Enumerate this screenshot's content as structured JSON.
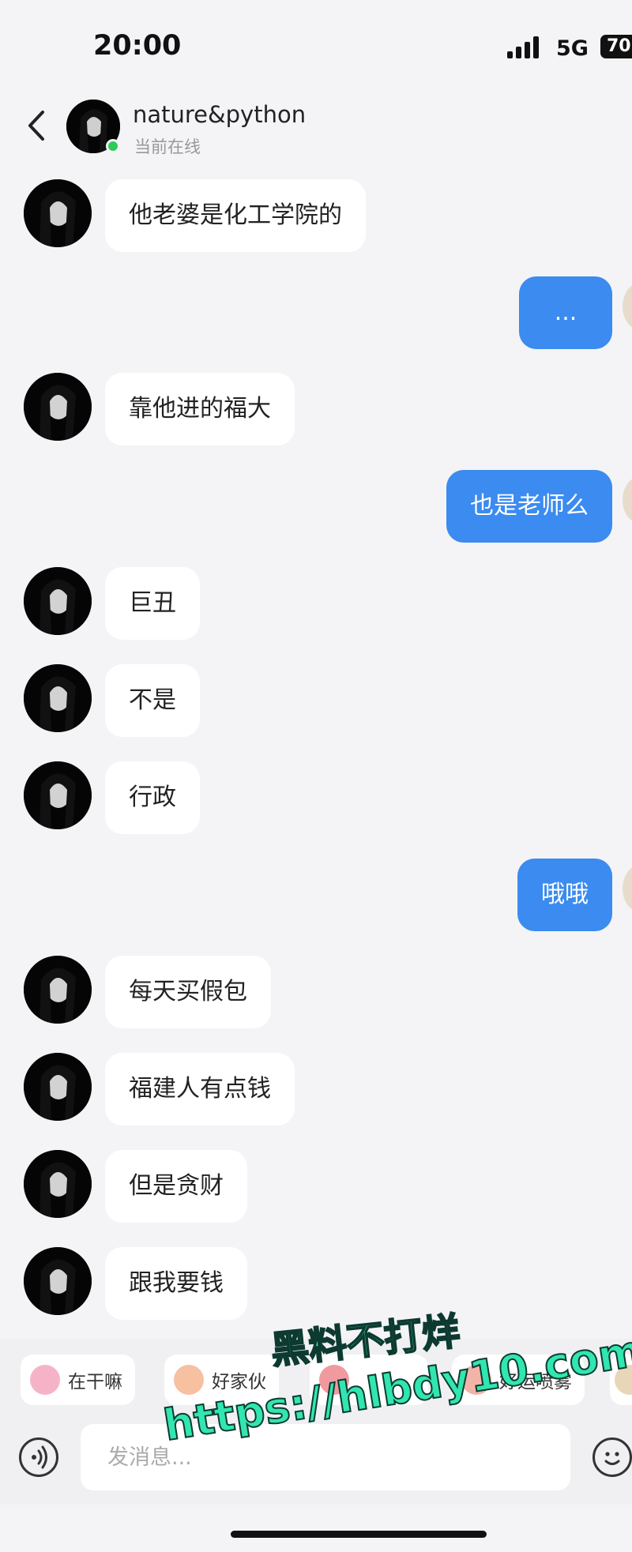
{
  "status_bar": {
    "time": "20:00",
    "network": "5G",
    "battery": "70"
  },
  "header": {
    "contact_name": "nature&python",
    "contact_status": "当前在线"
  },
  "messages": [
    {
      "side": "in",
      "text": "他老婆是化工学院的"
    },
    {
      "side": "out",
      "text": "..."
    },
    {
      "side": "in",
      "text": "靠他进的福大"
    },
    {
      "side": "out",
      "text": "也是老师么"
    },
    {
      "side": "in",
      "text": "巨丑"
    },
    {
      "side": "in",
      "text": "不是"
    },
    {
      "side": "in",
      "text": "行政"
    },
    {
      "side": "out",
      "text": "哦哦"
    },
    {
      "side": "in",
      "text": "每天买假包"
    },
    {
      "side": "in",
      "text": "福建人有点钱"
    },
    {
      "side": "in",
      "text": "但是贪财"
    },
    {
      "side": "in",
      "text": "跟我要钱"
    }
  ],
  "quick_replies": [
    {
      "label": "在干嘛",
      "icon": "sticker-icon",
      "color": "#f6b3c8"
    },
    {
      "label": "好家伙",
      "icon": "sticker-icon",
      "color": "#f7c0a0"
    },
    {
      "label": "",
      "icon": "sticker-icon",
      "color": "#f09aa0"
    },
    {
      "label": "好运喷雾",
      "icon": "sticker-icon",
      "color": "#f2b4a8"
    },
    {
      "label": "",
      "icon": "sticker-icon",
      "color": "#e8d6b8"
    }
  ],
  "input": {
    "placeholder": "发消息..."
  },
  "watermark": {
    "line1": "黑料不打烊",
    "line2": "https://hlbdy10.com"
  },
  "colors": {
    "outgoing_bubble": "#3b8bf0",
    "incoming_bubble": "#ffffff",
    "online": "#2ecb5a"
  }
}
